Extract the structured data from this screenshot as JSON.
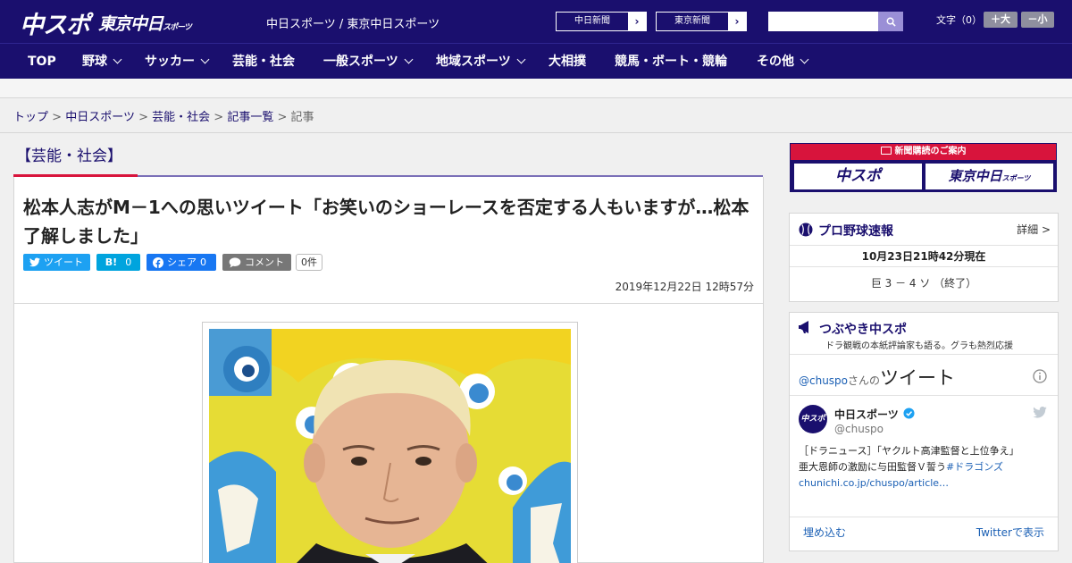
{
  "header": {
    "logo_main": "中スポ",
    "logo_tokyo": "東京中日",
    "logo_tokyo_small": "スポーツ",
    "site_names": "中日スポーツ / 東京中日スポーツ",
    "ext_links": [
      "中日新聞",
      "東京新聞"
    ],
    "font_size_label": "文字（0）",
    "font_up": "＋大",
    "font_down": "－小"
  },
  "nav": {
    "items": [
      {
        "label": "TOP",
        "dropdown": false
      },
      {
        "label": "野球",
        "dropdown": true
      },
      {
        "label": "サッカー",
        "dropdown": true
      },
      {
        "label": "芸能・社会",
        "dropdown": false
      },
      {
        "label": "一般スポーツ",
        "dropdown": true
      },
      {
        "label": "地域スポーツ",
        "dropdown": true
      },
      {
        "label": "大相撲",
        "dropdown": false
      },
      {
        "label": "競馬・ボート・競輪",
        "dropdown": false
      },
      {
        "label": "その他",
        "dropdown": true
      }
    ]
  },
  "breadcrumb": {
    "items": [
      "トップ",
      "中日スポーツ",
      "芸能・社会",
      "記事一覧"
    ],
    "current": "記事",
    "separator": ">"
  },
  "article": {
    "category": "【芸能・社会】",
    "title": "松本人志がM－1への思いツイート「お笑いのショーレースを否定する人もいますが…松本了解しました」",
    "share": {
      "tweet": "ツイート",
      "hatena": "B!",
      "hatena_count": "0",
      "facebook": "シェア",
      "facebook_count": "0",
      "comment": "コメント",
      "comment_count": "0件"
    },
    "date": "2019年12月22日 12時57分"
  },
  "sidebar": {
    "subscribe_title": "新聞購読のご案内",
    "subscribe_logo1": "中スポ",
    "subscribe_logo2": "東京中日",
    "subscribe_logo2_small": "スポーツ",
    "baseball": {
      "title": "プロ野球速報",
      "detail": "詳細 >",
      "timestamp": "10月23日21時42分現在",
      "score": "巨 3 － 4 ソ （終了）"
    },
    "tsubuyaki": {
      "title": "つぶやき中スポ",
      "subtitle": "ドラ観戦の本紙評論家も語る。グラも熱烈応援",
      "handle_prefix": "@chuspo",
      "handle_suffix": "さんの",
      "tweets_label": "ツイート",
      "account_name": "中日スポーツ",
      "account_handle": "@chuspo",
      "avatar_text": "中スポ",
      "tweet_line1": "［ドラニュース］「ヤクルト高津監督と上位争え」",
      "tweet_line2_text": "亜大恩師の激励に与田監督Ｖ誓う",
      "tweet_hashtag": "#ドラゴンズ",
      "tweet_link": "chunichi.co.jp/chuspo/article…",
      "embed": "埋め込む",
      "view_on_twitter": "Twitterで表示"
    }
  },
  "colors": {
    "brand_navy": "#1a0f6e",
    "accent_red": "#d8143c",
    "twitter": "#1da1f2",
    "hatena": "#00a4de",
    "facebook": "#1877f2",
    "comment_gray": "#777777"
  }
}
